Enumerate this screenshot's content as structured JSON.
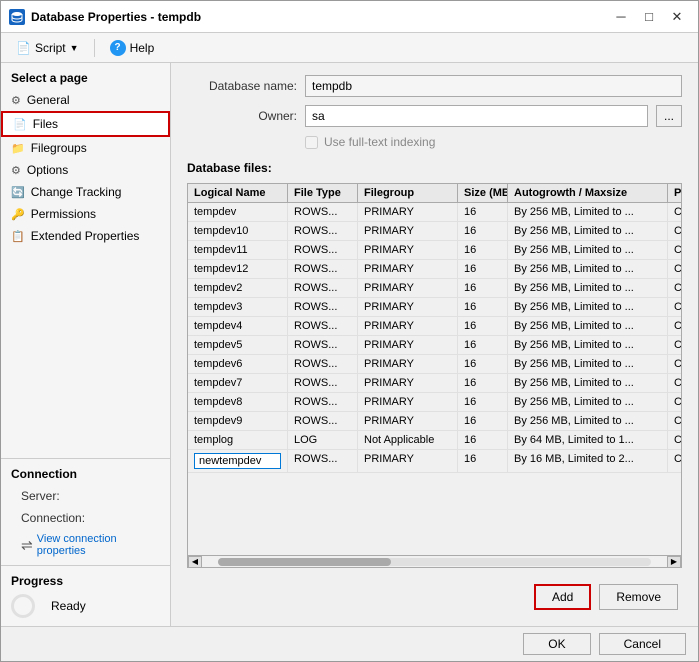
{
  "window": {
    "title": "Database Properties - tempdb",
    "icon": "db"
  },
  "toolbar": {
    "script_label": "Script",
    "help_label": "Help"
  },
  "sidebar": {
    "select_page_label": "Select a page",
    "items": [
      {
        "label": "General",
        "icon": "⚙"
      },
      {
        "label": "Files",
        "icon": "📄",
        "highlighted": true
      },
      {
        "label": "Filegroups",
        "icon": "📁"
      },
      {
        "label": "Options",
        "icon": "⚙"
      },
      {
        "label": "Change Tracking",
        "icon": "🔄"
      },
      {
        "label": "Permissions",
        "icon": "🔑"
      },
      {
        "label": "Extended Properties",
        "icon": "📋"
      }
    ],
    "connection": {
      "header": "Connection",
      "server_label": "Server:",
      "server_value": "",
      "connection_label": "Connection:",
      "connection_value": "",
      "view_link": "View connection properties"
    },
    "progress": {
      "header": "Progress",
      "status": "Ready"
    }
  },
  "form": {
    "db_name_label": "Database name:",
    "db_name_value": "tempdb",
    "owner_label": "Owner:",
    "owner_value": "sa",
    "browse_btn": "...",
    "full_text_label": "Use full-text indexing",
    "db_files_label": "Database files:",
    "columns": [
      {
        "label": "Logical Name",
        "key": "name"
      },
      {
        "label": "File Type",
        "key": "type"
      },
      {
        "label": "Filegroup",
        "key": "filegroup"
      },
      {
        "label": "Size (MB)",
        "key": "size"
      },
      {
        "label": "Autogrowth / Maxsize",
        "key": "auto"
      },
      {
        "label": "Path",
        "key": "path"
      }
    ],
    "rows": [
      {
        "name": "tempdev",
        "type": "ROWS...",
        "filegroup": "PRIMARY",
        "size": "16",
        "auto": "By 256 MB, Limited to ...",
        "path": "C:\\"
      },
      {
        "name": "tempdev10",
        "type": "ROWS...",
        "filegroup": "PRIMARY",
        "size": "16",
        "auto": "By 256 MB, Limited to ...",
        "path": "C:\\"
      },
      {
        "name": "tempdev11",
        "type": "ROWS...",
        "filegroup": "PRIMARY",
        "size": "16",
        "auto": "By 256 MB, Limited to ...",
        "path": "C:\\"
      },
      {
        "name": "tempdev12",
        "type": "ROWS...",
        "filegroup": "PRIMARY",
        "size": "16",
        "auto": "By 256 MB, Limited to ...",
        "path": "C:\\"
      },
      {
        "name": "tempdev2",
        "type": "ROWS...",
        "filegroup": "PRIMARY",
        "size": "16",
        "auto": "By 256 MB, Limited to ...",
        "path": "C:\\"
      },
      {
        "name": "tempdev3",
        "type": "ROWS...",
        "filegroup": "PRIMARY",
        "size": "16",
        "auto": "By 256 MB, Limited to ...",
        "path": "C:\\"
      },
      {
        "name": "tempdev4",
        "type": "ROWS...",
        "filegroup": "PRIMARY",
        "size": "16",
        "auto": "By 256 MB, Limited to ...",
        "path": "C:\\"
      },
      {
        "name": "tempdev5",
        "type": "ROWS...",
        "filegroup": "PRIMARY",
        "size": "16",
        "auto": "By 256 MB, Limited to ...",
        "path": "C:\\"
      },
      {
        "name": "tempdev6",
        "type": "ROWS...",
        "filegroup": "PRIMARY",
        "size": "16",
        "auto": "By 256 MB, Limited to ...",
        "path": "C:\\"
      },
      {
        "name": "tempdev7",
        "type": "ROWS...",
        "filegroup": "PRIMARY",
        "size": "16",
        "auto": "By 256 MB, Limited to ...",
        "path": "C:\\"
      },
      {
        "name": "tempdev8",
        "type": "ROWS...",
        "filegroup": "PRIMARY",
        "size": "16",
        "auto": "By 256 MB, Limited to ...",
        "path": "C:\\"
      },
      {
        "name": "tempdev9",
        "type": "ROWS...",
        "filegroup": "PRIMARY",
        "size": "16",
        "auto": "By 256 MB, Limited to ...",
        "path": "C:\\"
      },
      {
        "name": "templog",
        "type": "LOG",
        "filegroup": "Not Applicable",
        "size": "16",
        "auto": "By 64 MB, Limited to 1...",
        "path": "C:\\"
      },
      {
        "name": "newtempdev",
        "type": "ROWS...",
        "filegroup": "PRIMARY",
        "size": "16",
        "auto": "By 16 MB, Limited to 2...",
        "path": "C:\\"
      }
    ],
    "add_btn": "Add",
    "remove_btn": "Remove",
    "ok_btn": "OK",
    "cancel_btn": "Cancel"
  },
  "colors": {
    "highlight_border": "#cc0000",
    "link_color": "#0066cc",
    "active_nav": "#cce4ff"
  }
}
